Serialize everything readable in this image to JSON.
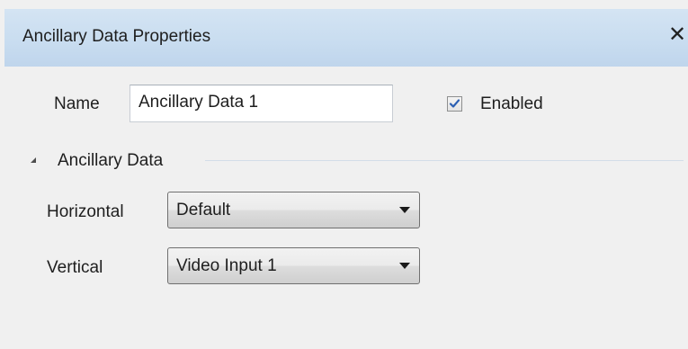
{
  "window": {
    "title": "Ancillary Data Properties",
    "close_glyph": "✕"
  },
  "general": {
    "name_label": "Name",
    "name_value": "Ancillary Data 1",
    "enabled_label": "Enabled",
    "enabled_checked": true
  },
  "section": {
    "title": "Ancillary Data",
    "expanded": true
  },
  "fields": {
    "horizontal_label": "Horizontal",
    "horizontal_value": "Default",
    "vertical_label": "Vertical",
    "vertical_value": "Video Input 1"
  },
  "icons": {
    "close": "close-icon",
    "checkmark": "checkmark-icon",
    "collapse": "triangle-expanded-icon",
    "dropdown": "chevron-down-icon"
  },
  "colors": {
    "title_bar": "#c9ddf0",
    "panel_bg": "#f0f0f0",
    "checkmark": "#2b5fb3"
  }
}
